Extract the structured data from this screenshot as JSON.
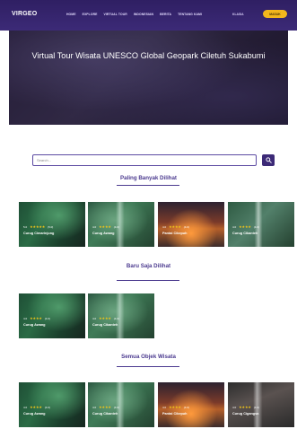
{
  "nav": {
    "brand": "VIRGEO",
    "menu": [
      "HOME",
      "EXPLORE",
      "VIRTUAL TOUR",
      "INDONESIAN",
      "BERITA",
      "TENTANG KAMI"
    ],
    "language": "KLASIA",
    "cta": "MASUK"
  },
  "hero": {
    "title": "Virtual Tour Wisata UNESCO Global Geopark Ciletuh Sukabumi"
  },
  "search": {
    "placeholder": "Search..."
  },
  "sections": {
    "popular": {
      "title": "Paling Banyak Dilihat",
      "cards": [
        {
          "name": "Curug Cimarinjung",
          "meta_left": "5.0",
          "meta_right": "(5.0)"
        },
        {
          "name": "Curug Awang",
          "meta_left": "4.0",
          "meta_right": "(4.0)"
        },
        {
          "name": "Pantai Cikepuh",
          "meta_left": "4.0",
          "meta_right": "(4.0)"
        },
        {
          "name": "Curug Cikanteh",
          "meta_left": "4.0",
          "meta_right": "(4.0)"
        }
      ]
    },
    "recent": {
      "title": "Baru Saja Dilihat",
      "cards": [
        {
          "name": "Curug Awang",
          "meta_left": "4.0",
          "meta_right": "(4.0)"
        },
        {
          "name": "Curug Cikanteh",
          "meta_left": "4.0",
          "meta_right": "(4.0)"
        }
      ]
    },
    "all": {
      "title": "Semua Objek Wisata",
      "cards": [
        {
          "name": "Curug Awang",
          "meta_left": "4.0",
          "meta_right": "(4.0)"
        },
        {
          "name": "Curug Cikanteh",
          "meta_left": "4.0",
          "meta_right": "(4.0)"
        },
        {
          "name": "Pantai Cikepuh",
          "meta_left": "4.0",
          "meta_right": "(4.0)"
        },
        {
          "name": "Curug Cigangsa",
          "meta_left": "4.0",
          "meta_right": "(4.0)"
        }
      ]
    }
  },
  "icons": {
    "search_button_icon": "search-icon",
    "rating_icon": "star-icon"
  },
  "colors": {
    "primary": "#3c2a77",
    "accent": "#f2b61c",
    "section_title": "#4b3a8f"
  }
}
